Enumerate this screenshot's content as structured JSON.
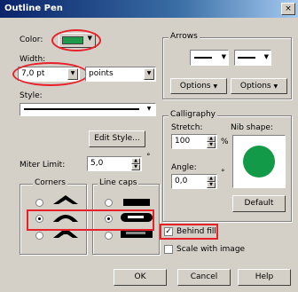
{
  "window": {
    "title": "Outline Pen",
    "close_glyph": "×"
  },
  "color": {
    "label": "Color:",
    "swatch": "#1f9a4a"
  },
  "width": {
    "label": "Width:",
    "value": "7,0 pt",
    "units": "points"
  },
  "style": {
    "label": "Style:",
    "edit_button": "Edit Style..."
  },
  "miter": {
    "label": "Miter Limit:",
    "value": "5,0",
    "unit": "°"
  },
  "corners": {
    "label": "Corners",
    "selected": 1
  },
  "line_caps": {
    "label": "Line caps",
    "selected": 1
  },
  "arrows": {
    "label": "Arrows",
    "options_left": "Options",
    "options_right": "Options"
  },
  "calligraphy": {
    "label": "Calligraphy",
    "stretch_label": "Stretch:",
    "stretch_value": "100",
    "stretch_unit": "%",
    "angle_label": "Angle:",
    "angle_value": "0,0",
    "angle_unit": "°",
    "nib_label": "Nib shape:",
    "nib_color": "#129a48",
    "default_button": "Default"
  },
  "behind_fill": {
    "label": "Behind fill",
    "checked": true
  },
  "scale_with_image": {
    "label": "Scale with image",
    "checked": false
  },
  "buttons": {
    "ok": "OK",
    "cancel": "Cancel",
    "help": "Help"
  },
  "colors": {
    "highlight": "#e8202a"
  }
}
